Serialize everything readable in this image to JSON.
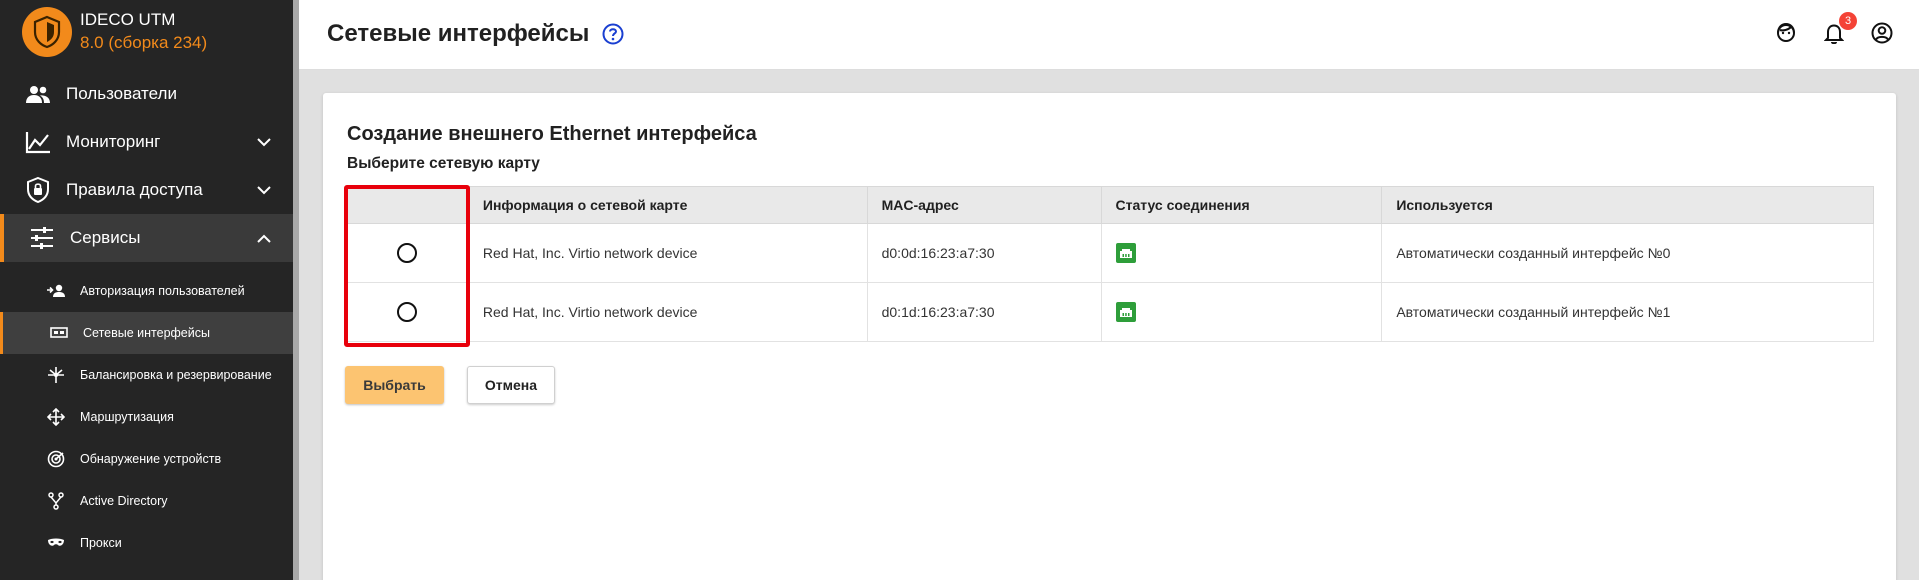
{
  "app": {
    "name": "IDECO UTM",
    "version": "8.0 (сборка 234)",
    "accent": "#f28a1b"
  },
  "sidebar": {
    "items": [
      {
        "label": "Пользователи",
        "icon": "users-icon",
        "has_chevron": false
      },
      {
        "label": "Мониторинг",
        "icon": "chart-line-icon",
        "chevron": "chevron-down-icon"
      },
      {
        "label": "Правила доступа",
        "icon": "shield-lock-icon",
        "chevron": "chevron-down-icon"
      },
      {
        "label": "Сервисы",
        "icon": "sliders-icon",
        "chevron": "chevron-up-icon",
        "expanded": true
      }
    ],
    "sub_items": [
      {
        "label": "Авторизация пользователей",
        "icon": "user-auth-icon"
      },
      {
        "label": "Сетевые интерфейсы",
        "icon": "network-card-icon",
        "active": true
      },
      {
        "label": "Балансировка и резервирование",
        "icon": "balance-icon"
      },
      {
        "label": "Маршрутизация",
        "icon": "routing-icon"
      },
      {
        "label": "Обнаружение устройств",
        "icon": "radar-icon"
      },
      {
        "label": "Active Directory",
        "icon": "branch-icon"
      },
      {
        "label": "Прокси",
        "icon": "mask-icon"
      }
    ]
  },
  "header": {
    "title": "Сетевые интерфейсы",
    "notifications_count": "3"
  },
  "card": {
    "title": "Создание внешнего Ethernet интерфейса",
    "subtitle": "Выберите сетевую карту",
    "columns": [
      "",
      "Информация о сетевой карте",
      "MAC-адрес",
      "Статус соединения",
      "Используется"
    ],
    "rows": [
      {
        "info": "Red Hat, Inc. Virtio network device",
        "mac": "d0:0d:16:23:a7:30",
        "status": "connected",
        "used": "Автоматически созданный интерфейс №0"
      },
      {
        "info": "Red Hat, Inc. Virtio network device",
        "mac": "d0:1d:16:23:a7:30",
        "status": "connected",
        "used": "Автоматически созданный интерфейс №1"
      }
    ],
    "select_label": "Выбрать",
    "cancel_label": "Отмена"
  },
  "colors": {
    "status_ok": "#2e9e3a",
    "highlight": "#e8000b",
    "primary_button": "#fcc471"
  }
}
